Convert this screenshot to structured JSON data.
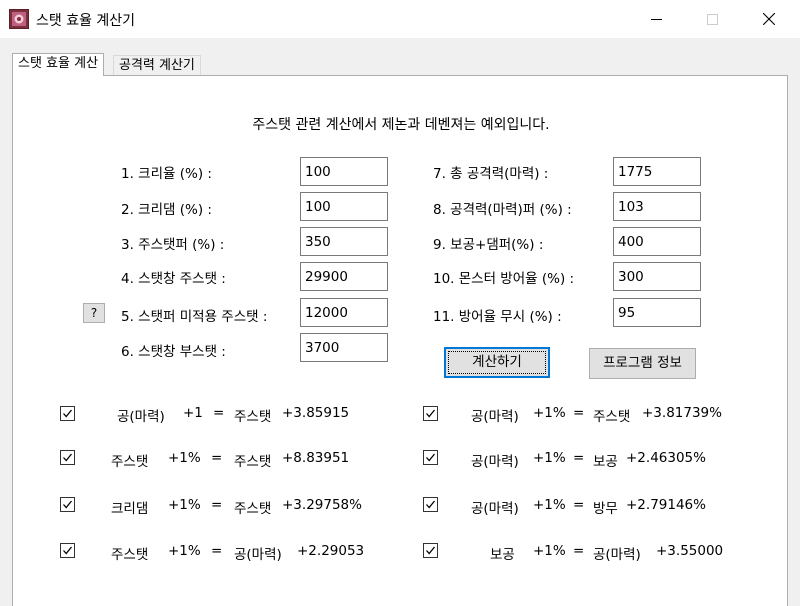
{
  "window": {
    "title": "스탯 효율 계산기",
    "icon": "app-icon",
    "controls": [
      "minimize-icon",
      "maximize-icon",
      "close-icon"
    ]
  },
  "tabs": [
    {
      "label": "스탯 효율 계산",
      "active": true
    },
    {
      "label": "공격력 계산기",
      "active": false
    }
  ],
  "notice": "주스탯 관련 계산에서 제논과 데벤져는 예외입니다.",
  "left_fields": [
    {
      "label": "1. 크리율 (%) :",
      "value": "100"
    },
    {
      "label": "2. 크리댐 (%) :",
      "value": "100"
    },
    {
      "label": "3. 주스탯퍼 (%) :",
      "value": "350"
    },
    {
      "label": "4. 스탯창 주스탯 :",
      "value": "29900"
    },
    {
      "label": "5. 스탯퍼 미적용 주스탯 :",
      "value": "12000"
    },
    {
      "label": "6. 스탯창 부스탯 :",
      "value": "3700"
    }
  ],
  "right_fields": [
    {
      "label": "7. 총 공격력(마력) :",
      "value": "1775"
    },
    {
      "label": "8. 공격력(마력)퍼 (%) :",
      "value": "103"
    },
    {
      "label": "9. 보공+댐퍼(%) :",
      "value": "400"
    },
    {
      "label": "10. 몬스터 방어율 (%) :",
      "value": "300"
    },
    {
      "label": "11. 방어율 무시 (%) :",
      "value": "95"
    }
  ],
  "help_button": "?",
  "buttons": {
    "calculate": "계산하기",
    "info": "프로그램 정보"
  },
  "results_left": [
    {
      "checked": true,
      "a": "공(마력)",
      "b": "+1",
      "eq": "=",
      "c": "주스탯",
      "d": "+3.85915"
    },
    {
      "checked": true,
      "a": "주스탯",
      "b": "+1%",
      "eq": "=",
      "c": "주스탯",
      "d": "+8.83951"
    },
    {
      "checked": true,
      "a": "크리댐",
      "b": "+1%",
      "eq": "=",
      "c": "주스탯",
      "d": "+3.29758%"
    },
    {
      "checked": true,
      "a": "주스탯",
      "b": "+1%",
      "eq": "=",
      "c": "공(마력)",
      "d": "+2.29053"
    }
  ],
  "results_right": [
    {
      "checked": true,
      "a": "공(마력)",
      "b": "+1%",
      "eq": "=",
      "c": "주스탯",
      "d": "+3.81739%"
    },
    {
      "checked": true,
      "a": "공(마력)",
      "b": "+1%",
      "eq": "=",
      "c": "보공",
      "d": "+2.46305%"
    },
    {
      "checked": true,
      "a": "공(마력)",
      "b": "+1%",
      "eq": "=",
      "c": "방무",
      "d": "+2.79146%"
    },
    {
      "checked": true,
      "a": "보공",
      "b": "+1%",
      "eq": "=",
      "c": "공(마력)",
      "d": "+3.55000"
    }
  ]
}
